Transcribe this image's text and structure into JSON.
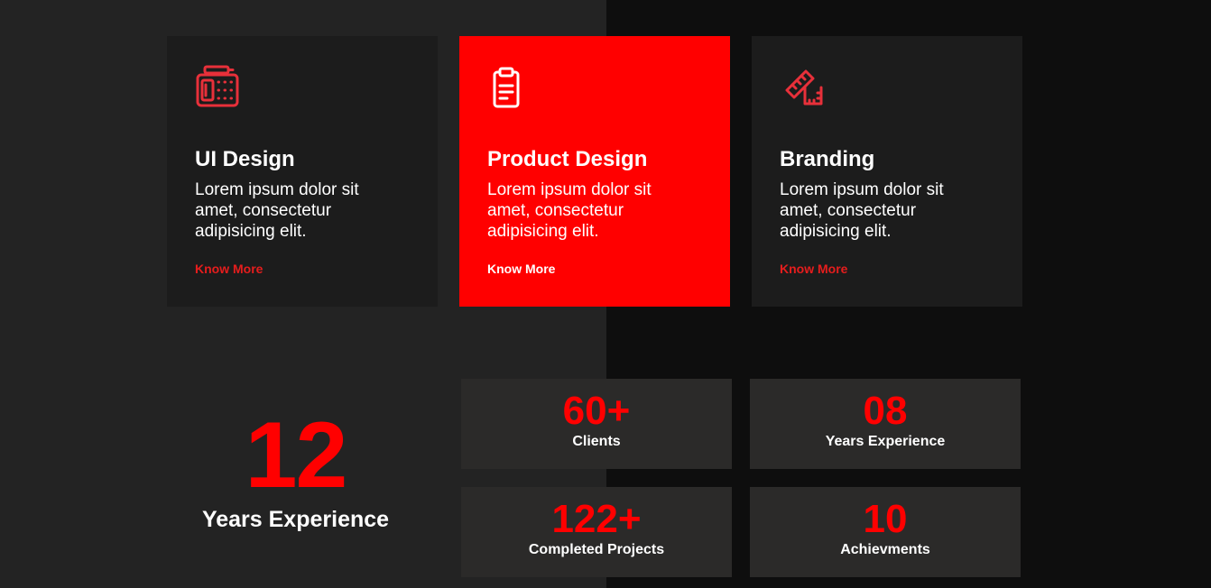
{
  "services": [
    {
      "icon": "calculator-pen-icon",
      "title": "UI Design",
      "text": "Lorem ipsum dolor sit amet, consectetur adipisicing elit.",
      "link": "Know More",
      "active": false
    },
    {
      "icon": "clipboard-icon",
      "title": "Product Design",
      "text": "Lorem ipsum dolor sit amet, consectetur adipisicing elit.",
      "link": "Know More",
      "active": true
    },
    {
      "icon": "ruler-square-icon",
      "title": "Branding",
      "text": "Lorem ipsum dolor sit amet, consectetur adipisicing elit.",
      "link": "Know More",
      "active": false
    }
  ],
  "experience": {
    "number": "12",
    "label": "Years Experience"
  },
  "stats": [
    {
      "number": "60+",
      "label": "Clients"
    },
    {
      "number": "08",
      "label": "Years Experience"
    },
    {
      "number": "122+",
      "label": "Completed Projects"
    },
    {
      "number": "10",
      "label": "Achievments"
    }
  ],
  "colors": {
    "accent": "#ff0000",
    "icon_accent": "#e8303a",
    "card_bg": "#1c1c1c",
    "stat_bg": "#2b2a29",
    "left_bg": "#232323",
    "right_bg": "#0e0e0e"
  }
}
